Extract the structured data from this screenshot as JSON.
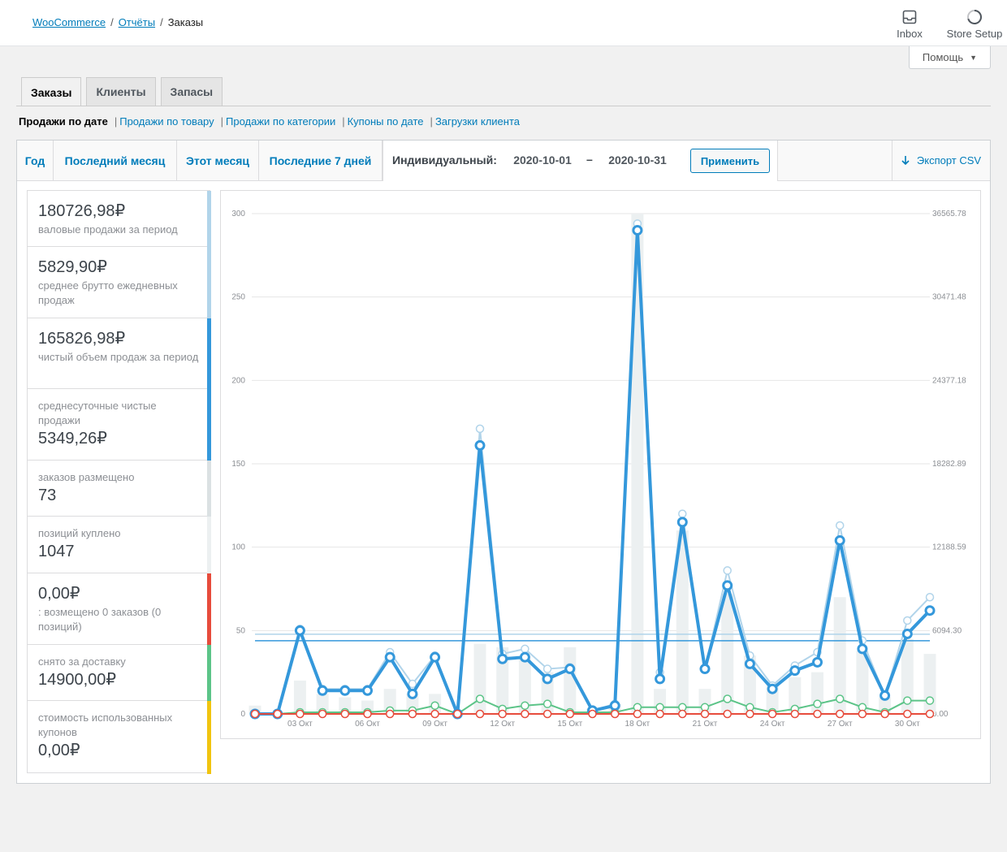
{
  "breadcrumb": {
    "root": "WooCommerce",
    "section": "Отчёты",
    "current": "Заказы"
  },
  "header": {
    "inbox_label": "Inbox",
    "store_setup_label": "Store Setup",
    "help_label": "Помощь"
  },
  "tabs": [
    {
      "label": "Заказы",
      "active": true
    },
    {
      "label": "Клиенты",
      "active": false
    },
    {
      "label": "Запасы",
      "active": false
    }
  ],
  "subnav": {
    "current": "Продажи по дате",
    "links": [
      "Продажи по товару",
      "Продажи по категории",
      "Купоны по дате",
      "Загрузки клиента"
    ]
  },
  "ranges": [
    "Год",
    "Последний месяц",
    "Этот месяц",
    "Последние 7 дней"
  ],
  "custom_range": {
    "label": "Индивидуальный:",
    "from": "2020-10-01",
    "dash": "–",
    "to": "2020-10-31",
    "apply_label": "Применить"
  },
  "export_label": "Экспорт CSV",
  "legend": [
    {
      "value": "180726,98₽",
      "label": "валовые продажи за период",
      "value_first": true,
      "color": "#b1d4ea"
    },
    {
      "value": "5829,90₽",
      "label": "среднее брутто ежедневных продаж",
      "value_first": true,
      "color": "#b1d4ea"
    },
    {
      "value": "165826,98₽",
      "label": "чистый объем продаж за период",
      "value_first": true,
      "color": "#3498db"
    },
    {
      "value": "5349,26₽",
      "label": "среднесуточные чистые продажи",
      "value_first": false,
      "color": "#3498db"
    },
    {
      "value": "73",
      "label": "заказов размещено",
      "value_first": false,
      "color": "#dbe1e3"
    },
    {
      "value": "1047",
      "label": "позиций куплено",
      "value_first": false,
      "color": "#ecf0f1"
    },
    {
      "value": "0,00₽",
      "label": ": возмещено 0 заказов (0 позиций)",
      "value_first": true,
      "color": "#e74c3c"
    },
    {
      "value": "14900,00₽",
      "label": "снято за доставку",
      "value_first": false,
      "color": "#5cc488"
    },
    {
      "value": "0,00₽",
      "label": "стоимость использованных купонов",
      "value_first": false,
      "color": "#f1c40f"
    }
  ],
  "chart_data": {
    "type": "line",
    "x_labels": [
      "03 Окт",
      "06 Окт",
      "09 Окт",
      "12 Окт",
      "15 Окт",
      "18 Окт",
      "21 Окт",
      "24 Окт",
      "27 Окт",
      "30 Окт"
    ],
    "left_ticks": [
      0,
      50,
      100,
      150,
      200,
      250,
      300
    ],
    "right_ticks": [
      "0.00",
      "6094.30",
      "12188.59",
      "18282.89",
      "24377.18",
      "30471.48",
      "36565.78"
    ],
    "ylim_left": [
      0,
      300
    ],
    "days": [
      1,
      2,
      3,
      4,
      5,
      6,
      7,
      8,
      9,
      10,
      11,
      12,
      13,
      14,
      15,
      16,
      17,
      18,
      19,
      20,
      21,
      22,
      23,
      24,
      25,
      26,
      27,
      28,
      29,
      30,
      31
    ],
    "series": [
      {
        "key": "orders_bars",
        "style": "bar",
        "color": "#ecf0f1",
        "values": [
          5,
          0,
          20,
          12,
          10,
          8,
          15,
          12,
          12,
          0,
          42,
          40,
          33,
          25,
          40,
          3,
          6,
          300,
          15,
          110,
          15,
          72,
          35,
          18,
          22,
          25,
          70,
          38,
          10,
          45,
          36
        ]
      },
      {
        "key": "gross_sales",
        "style": "line-thin",
        "color": "#b1d4ea",
        "values": [
          0,
          0,
          51,
          15,
          15,
          15,
          37,
          18,
          35,
          0,
          171,
          36,
          39,
          27,
          28,
          2,
          6,
          294,
          25,
          120,
          27,
          86,
          35,
          17,
          29,
          37,
          113,
          44,
          11,
          56,
          70
        ]
      },
      {
        "key": "net_sales",
        "style": "line-thick",
        "color": "#3498db",
        "values": [
          0,
          0,
          50,
          14,
          14,
          14,
          34,
          12,
          34,
          0,
          161,
          33,
          34,
          21,
          27,
          2,
          5,
          290,
          21,
          115,
          27,
          77,
          30,
          15,
          26,
          31,
          104,
          39,
          11,
          48,
          62
        ]
      },
      {
        "key": "shipping",
        "style": "line-dots",
        "color": "#5cc488",
        "values": [
          0,
          0,
          1,
          1,
          1,
          1,
          2,
          2,
          5,
          0,
          9,
          3,
          5,
          6,
          1,
          1,
          1,
          4,
          4,
          4,
          4,
          9,
          4,
          1,
          3,
          6,
          9,
          4,
          1,
          8,
          8
        ]
      },
      {
        "key": "refunds",
        "style": "line-dots",
        "color": "#e74c3c",
        "values": [
          0,
          0,
          0,
          0,
          0,
          0,
          0,
          0,
          0,
          0,
          0,
          0,
          0,
          0,
          0,
          0,
          0,
          0,
          0,
          0,
          0,
          0,
          0,
          0,
          0,
          0,
          0,
          0,
          0,
          0,
          0
        ]
      }
    ],
    "averages": [
      {
        "key": "gross_avg",
        "color": "#b1d4ea",
        "value": 47.8
      },
      {
        "key": "net_avg",
        "color": "#3498db",
        "value": 43.9
      }
    ]
  }
}
